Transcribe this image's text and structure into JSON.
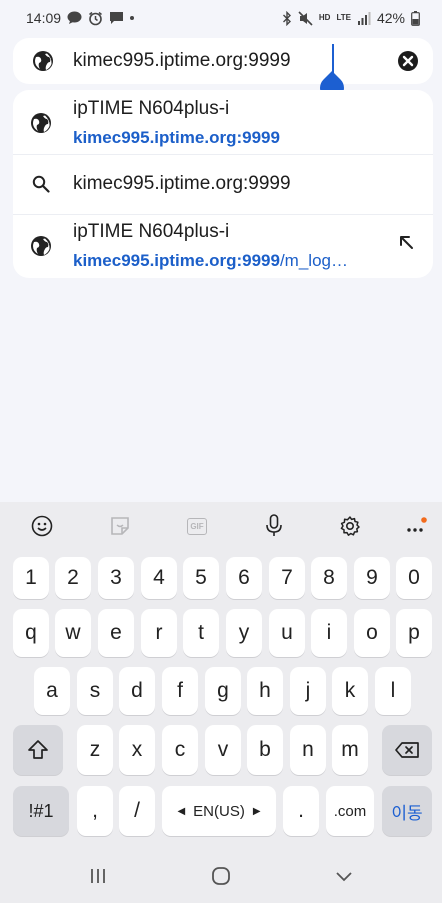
{
  "status_bar": {
    "time": "14:09",
    "battery": "42%",
    "hd": "HD",
    "lte": "LTE"
  },
  "url_bar": {
    "value": "kimec995.iptime.org:9999"
  },
  "suggestions": [
    {
      "type": "site",
      "title": "ipTIME N604plus-i",
      "url": "kimec995.iptime.org:9999",
      "url_rest": ""
    },
    {
      "type": "search",
      "title": "kimec995.iptime.org:9999"
    },
    {
      "type": "site",
      "title": "ipTIME N604plus-i",
      "url": "kimec995.iptime.org:9999",
      "url_rest": "/m_log…"
    }
  ],
  "keyboard": {
    "numbers": [
      "1",
      "2",
      "3",
      "4",
      "5",
      "6",
      "7",
      "8",
      "9",
      "0"
    ],
    "row1": [
      "q",
      "w",
      "e",
      "r",
      "t",
      "y",
      "u",
      "i",
      "o",
      "p"
    ],
    "row2": [
      "a",
      "s",
      "d",
      "f",
      "g",
      "h",
      "j",
      "k",
      "l"
    ],
    "row3": [
      "z",
      "x",
      "c",
      "v",
      "b",
      "n",
      "m"
    ],
    "symbols_key": "!#1",
    "comma_key": ",",
    "slash_key": "/",
    "language_key": "EN(US)",
    "period_key": ".",
    "dotcom_key": ".com",
    "go_key": "이동",
    "gif_label": "GIF"
  },
  "colors": {
    "accent": "#1c5fd1",
    "link": "#1c5fc9",
    "background": "#f4f5fa",
    "keyboard_bg": "#ececef",
    "notification_dot": "#f26b1d"
  }
}
